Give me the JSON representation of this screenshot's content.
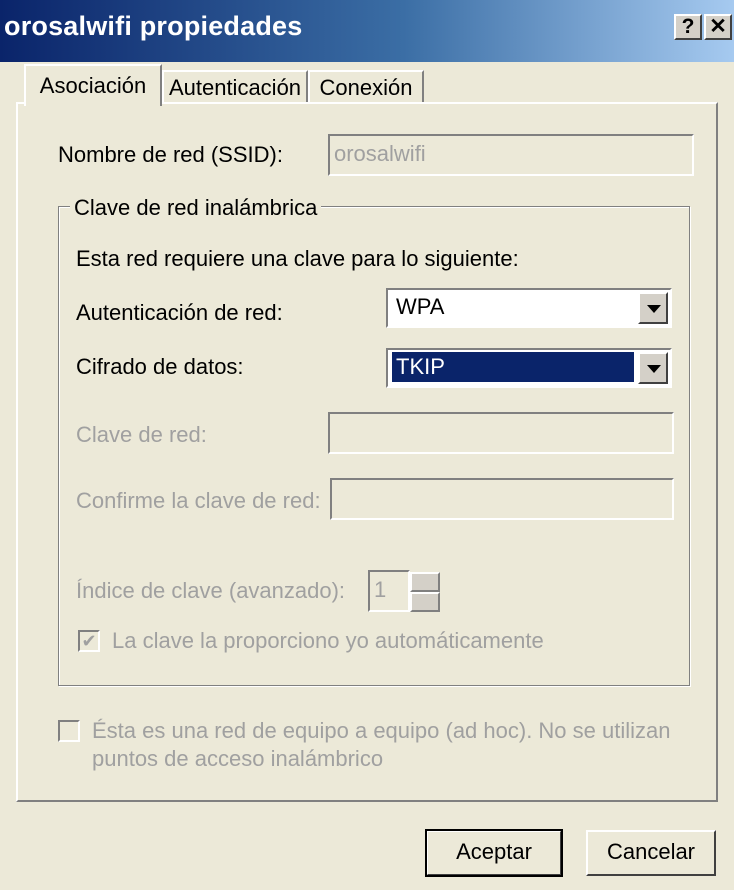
{
  "window": {
    "title": "orosalwifi propiedades",
    "help_label": "?",
    "close_label": "✕"
  },
  "tabs": [
    {
      "label": "Asociación",
      "active": true
    },
    {
      "label": "Autenticación",
      "active": false
    },
    {
      "label": "Conexión",
      "active": false
    }
  ],
  "ssid": {
    "label": "Nombre de red (SSID):",
    "value": "orosalwifi"
  },
  "wireless_key_group": {
    "legend": "Clave de red inalámbrica",
    "intro": "Esta red requiere una clave para lo siguiente:",
    "auth": {
      "label": "Autenticación de red:",
      "value": "WPA"
    },
    "encryption": {
      "label": "Cifrado de datos:",
      "value": "TKIP"
    },
    "network_key": {
      "label": "Clave de red:",
      "value": ""
    },
    "confirm_key": {
      "label": "Confirme la clave de red:",
      "value": ""
    },
    "key_index": {
      "label": "Índice de clave (avanzado):",
      "value": "1"
    },
    "auto_key": {
      "label": "La clave la proporciono yo automáticamente",
      "checked": true
    }
  },
  "adhoc": {
    "line1": "Ésta es una red de equipo a equipo (ad hoc). No se utilizan",
    "line2": "puntos de acceso inalámbrico",
    "checked": false
  },
  "buttons": {
    "ok": "Aceptar",
    "cancel": "Cancelar"
  },
  "colors": {
    "title_start": "#0a246a",
    "title_end": "#a6caf0",
    "selection": "#0a246a",
    "face": "#ece9d8"
  }
}
